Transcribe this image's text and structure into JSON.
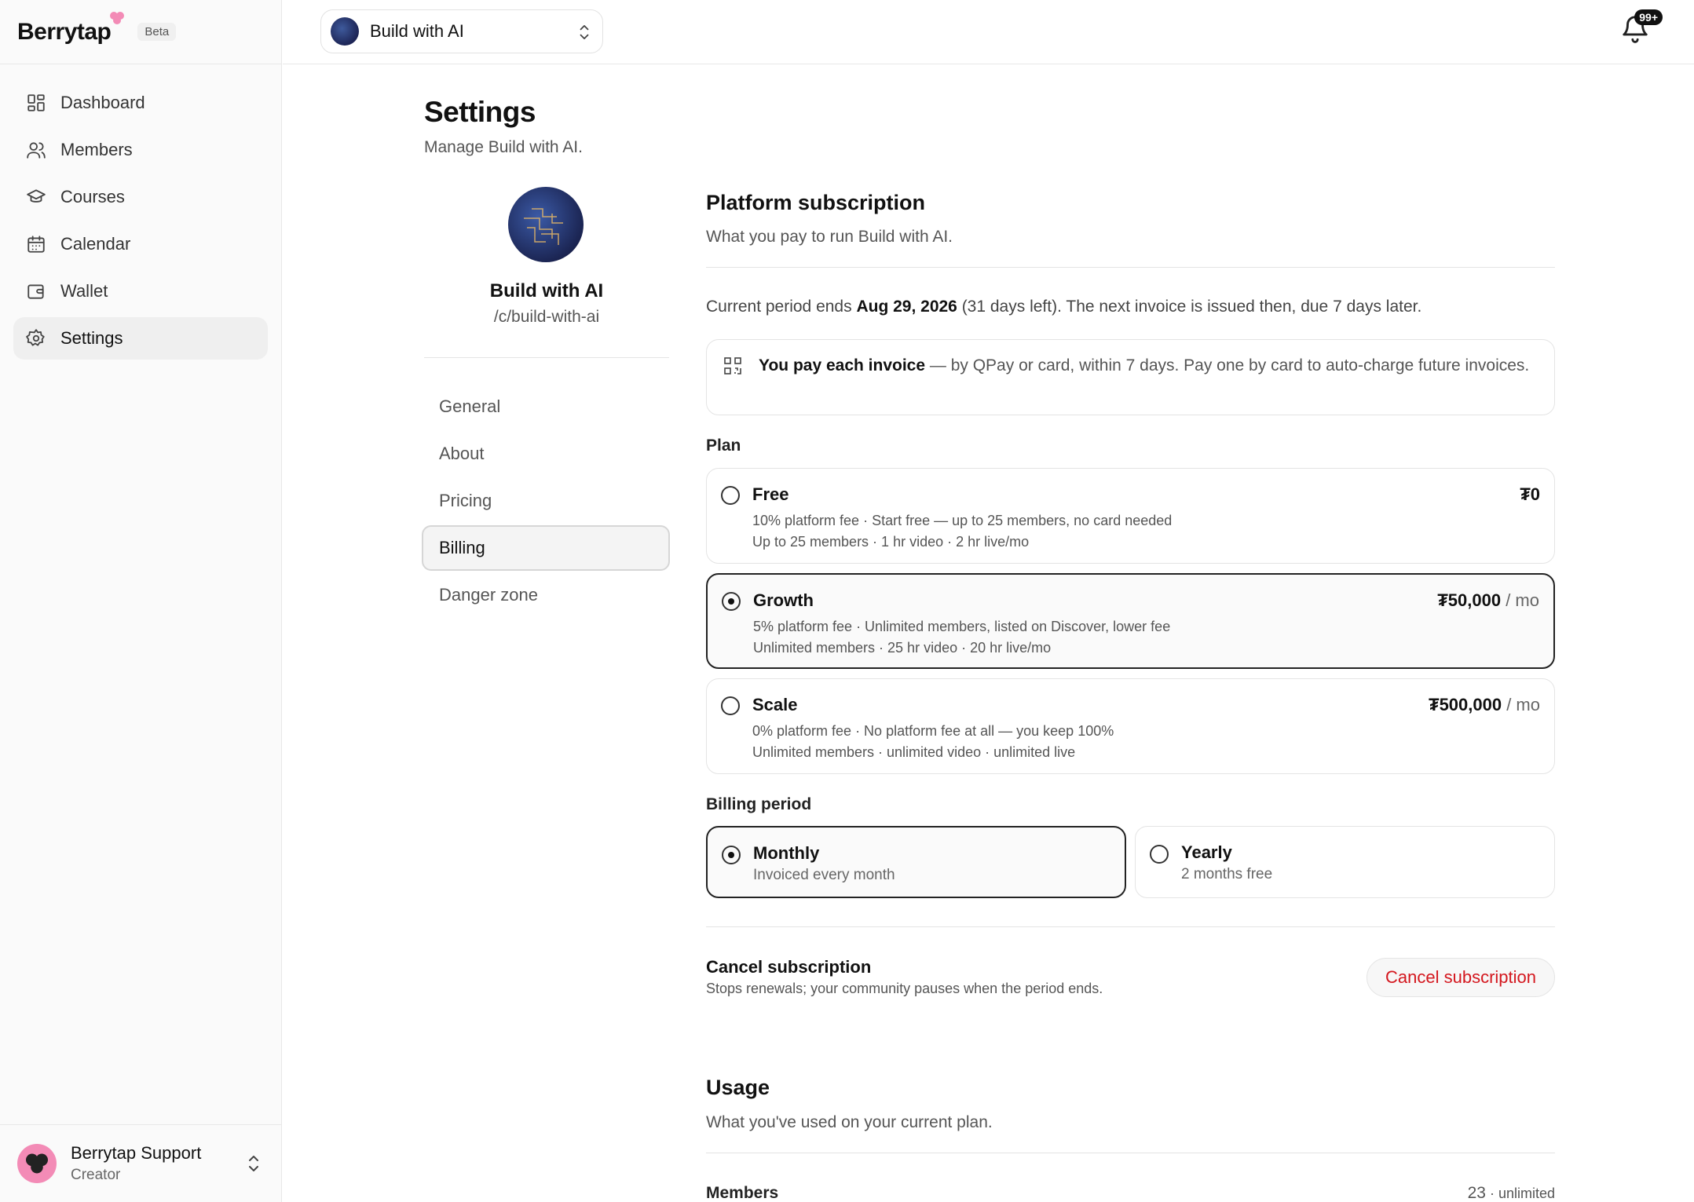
{
  "brand": {
    "name": "Berrytap",
    "badge": "Beta"
  },
  "sidebar": {
    "items": [
      {
        "label": "Dashboard",
        "icon": "dashboard-icon"
      },
      {
        "label": "Members",
        "icon": "users-icon"
      },
      {
        "label": "Courses",
        "icon": "graduation-cap-icon"
      },
      {
        "label": "Calendar",
        "icon": "calendar-icon"
      },
      {
        "label": "Wallet",
        "icon": "wallet-icon"
      },
      {
        "label": "Settings",
        "icon": "gear-icon",
        "active": true
      }
    ],
    "user": {
      "name": "Berrytap Support",
      "role": "Creator"
    }
  },
  "topbar": {
    "community_switcher": "Build with AI",
    "notifications_badge": "99+"
  },
  "header": {
    "title": "Settings",
    "subtitle": "Manage Build with AI."
  },
  "community": {
    "name": "Build with AI",
    "slug": "/c/build-with-ai"
  },
  "settings_nav": {
    "items": [
      "General",
      "About",
      "Pricing",
      "Billing",
      "Danger zone"
    ],
    "active": "Billing"
  },
  "subscription": {
    "title": "Platform subscription",
    "subtitle": "What you pay to run Build with AI.",
    "period_prefix": "Current period ends ",
    "period_date": "Aug 29, 2026",
    "period_suffix": " (31 days left). The next invoice is issued then, due 7 days later.",
    "notice_bold": "You pay each invoice",
    "notice_text": " — by QPay or card, within 7 days. Pay one by card to auto-charge future invoices.",
    "plan_label": "Plan",
    "plans": [
      {
        "name": "Free",
        "desc1": "10% platform fee · Start free — up to 25 members, no card needed",
        "desc2": "Up to 25 members · 1 hr video · 2 hr live/mo",
        "price": "₮0",
        "per": "",
        "selected": false
      },
      {
        "name": "Growth",
        "desc1": "5% platform fee · Unlimited members, listed on Discover, lower fee",
        "desc2": "Unlimited members · 25 hr video · 20 hr live/mo",
        "price": "₮50,000",
        "per": " / mo",
        "selected": true
      },
      {
        "name": "Scale",
        "desc1": "0% platform fee · No platform fee at all — you keep 100%",
        "desc2": "Unlimited members · unlimited video · unlimited live",
        "price": "₮500,000",
        "per": " / mo",
        "selected": false
      }
    ],
    "billing_label": "Billing period",
    "billing_options": [
      {
        "name": "Monthly",
        "desc": "Invoiced every month",
        "selected": true
      },
      {
        "name": "Yearly",
        "desc": "2 months free",
        "selected": false
      }
    ],
    "cancel_title": "Cancel subscription",
    "cancel_desc": "Stops renewals; your community pauses when the period ends.",
    "cancel_button": "Cancel subscription"
  },
  "usage": {
    "title": "Usage",
    "subtitle": "What you've used on your current plan.",
    "rows": [
      {
        "label": "Members",
        "used": "23",
        "limit": " · unlimited"
      }
    ]
  },
  "colors": {
    "danger": "#d4171e",
    "brand_pink": "#f38bb6",
    "accent": "#111111"
  }
}
